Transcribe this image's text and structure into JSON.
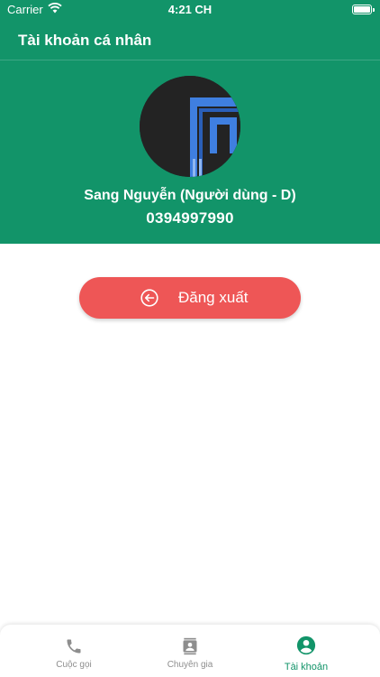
{
  "status_bar": {
    "carrier": "Carrier",
    "time": "4:21 CH"
  },
  "header": {
    "title": "Tài khoản cá nhân"
  },
  "profile": {
    "name": "Sang Nguyễn (Người dùng - D)",
    "phone": "0394997990"
  },
  "logout": {
    "label": "Đăng xuất",
    "icon": "arrow-left-circle-icon",
    "color": "#ee5656"
  },
  "tabs": [
    {
      "label": "Cuộc gọi",
      "icon": "phone-icon",
      "active": false
    },
    {
      "label": "Chuyên gia",
      "icon": "contacts-icon",
      "active": false
    },
    {
      "label": "Tài khoản",
      "icon": "account-circle-icon",
      "active": true
    }
  ],
  "colors": {
    "primary": "#129469",
    "inactive": "#8e8e8e"
  }
}
